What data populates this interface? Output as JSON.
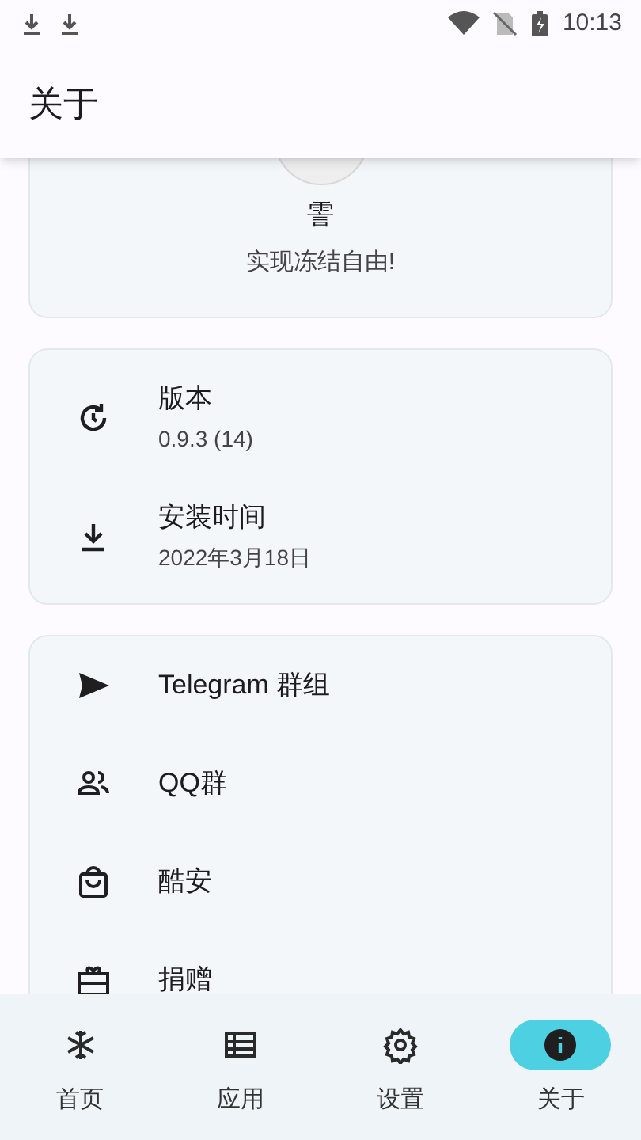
{
  "status_bar": {
    "time": "10:13"
  },
  "app_bar": {
    "title": "关于"
  },
  "header_card": {
    "app_name": "霅",
    "slogan": "实现冻结自由!"
  },
  "info_items": [
    {
      "title": "版本",
      "subtitle": "0.9.3 (14)"
    },
    {
      "title": "安装时间",
      "subtitle": "2022年3月18日"
    }
  ],
  "link_items": [
    {
      "title": "Telegram 群组"
    },
    {
      "title": "QQ群"
    },
    {
      "title": "酷安"
    },
    {
      "title": "捐赠"
    }
  ],
  "bottom_nav": [
    {
      "label": "首页",
      "selected": false
    },
    {
      "label": "应用",
      "selected": false
    },
    {
      "label": "设置",
      "selected": false
    },
    {
      "label": "关于",
      "selected": true
    }
  ]
}
